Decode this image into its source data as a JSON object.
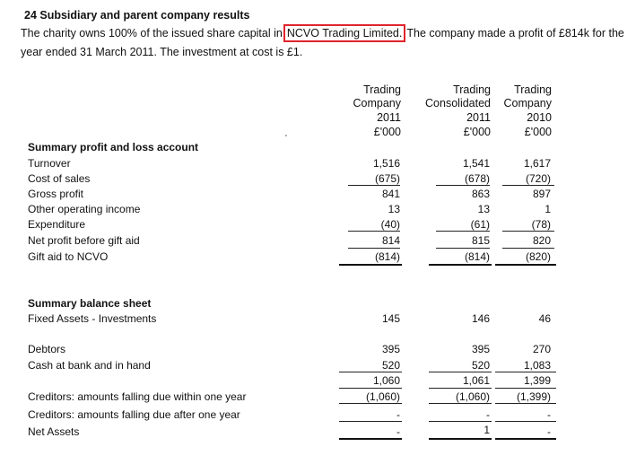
{
  "note": {
    "heading": "24 Subsidiary and parent company results",
    "para_before": "The charity owns 100% of the issued share capital in",
    "highlighted": "NCVO Trading Limited.",
    "para_after": "The company made a profit of £814k for the",
    "para_line2": "year ended 31 March 2011.  The investment at cost is £1."
  },
  "columns": [
    {
      "line1": "Trading",
      "line2": "Company",
      "year": "2011",
      "unit": "£'000"
    },
    {
      "line1": "Trading",
      "line2": "Consolidated",
      "year": "2011",
      "unit": "£'000"
    },
    {
      "line1": "Trading",
      "line2": "Company",
      "year": "2010",
      "unit": "£'000"
    }
  ],
  "pl": {
    "title": "Summary profit and loss account",
    "rows": [
      {
        "label": "Turnover",
        "values": [
          "1,516",
          "1,541",
          "1,617"
        ]
      },
      {
        "label": "Cost of sales",
        "values": [
          "(675)",
          "(678)",
          "(720)"
        ]
      },
      {
        "label": "Gross profit",
        "values": [
          "841",
          "863",
          "897"
        ]
      },
      {
        "label": "Other operating income",
        "values": [
          "13",
          "13",
          "1"
        ]
      },
      {
        "label": "Expenditure",
        "values": [
          "(40)",
          "(61)",
          "(78)"
        ]
      },
      {
        "label": "Net profit before gift aid",
        "values": [
          "814",
          "815",
          "820"
        ]
      },
      {
        "label": "Gift aid to NCVO",
        "values": [
          "(814)",
          "(814)",
          "(820)"
        ]
      }
    ]
  },
  "bs": {
    "title": "Summary balance sheet",
    "rows": [
      {
        "label": "Fixed Assets - Investments",
        "values": [
          "145",
          "146",
          "46"
        ]
      },
      {
        "label": "Debtors",
        "values": [
          "395",
          "395",
          "270"
        ]
      },
      {
        "label": "Cash at bank and in hand",
        "values": [
          "520",
          "520",
          "1,083"
        ]
      },
      {
        "label": "",
        "values": [
          "1,060",
          "1,061",
          "1,399"
        ]
      },
      {
        "label": "Creditors: amounts falling due within one year",
        "values": [
          "(1,060)",
          "(1,060)",
          "(1,399)"
        ]
      },
      {
        "label": "Creditors: amounts falling due after one year",
        "values": [
          "-",
          "-",
          "-"
        ]
      },
      {
        "label": "Net Assets",
        "values": [
          "-",
          "1",
          "-"
        ]
      }
    ]
  }
}
